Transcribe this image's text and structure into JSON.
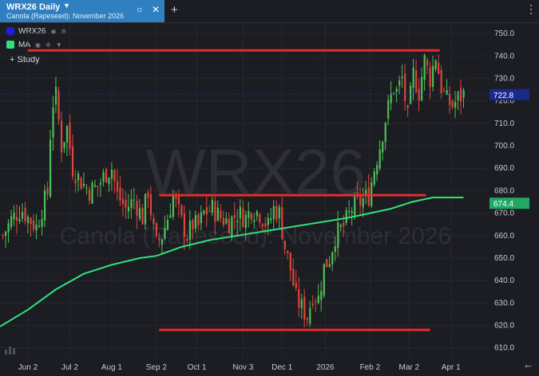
{
  "tab": {
    "title": "WRX26 Daily",
    "subtitle": "Canola (Rapeseed): November 2026",
    "close_glyph": "✕",
    "circle_glyph": "○",
    "add_glyph": "+",
    "more_glyph": "⋮"
  },
  "legend": [
    {
      "name": "WRX26",
      "color": "#1a1fe0"
    },
    {
      "name": "MA",
      "color": "#32e07c"
    }
  ],
  "study_label": "+ Study",
  "watermark": {
    "symbol": "WRX26",
    "description": "Canola (Rapeseed): November 2026"
  },
  "last_price_label": "722.8",
  "ma_price_label": "674.4",
  "back_glyph": "←",
  "colors": {
    "up": "#4fbf55",
    "down": "#e0453a",
    "ma": "#32e07c",
    "line": "#e52b2b",
    "price_badge": "#1a2a8a",
    "ma_badge": "#22a866"
  },
  "chart_data": {
    "type": "candlestick",
    "symbol": "WRX26",
    "interval": "Daily",
    "ylim": [
      606,
      755
    ],
    "y_ticks": [
      "750.0",
      "740.0",
      "730.0",
      "720.0",
      "710.0",
      "700.0",
      "690.0",
      "680.0",
      "670.0",
      "660.0",
      "650.0",
      "640.0",
      "630.0",
      "620.0",
      "610.0"
    ],
    "x_ticks": [
      {
        "label": "Jun 2",
        "day": 0
      },
      {
        "label": "Jul 2",
        "day": 30
      },
      {
        "label": "Aug 1",
        "day": 60
      },
      {
        "label": "Sep 2",
        "day": 92
      },
      {
        "label": "Oct 1",
        "day": 121
      },
      {
        "label": "Nov 3",
        "day": 154
      },
      {
        "label": "Dec 1",
        "day": 182
      },
      {
        "label": "2026",
        "day": 213
      },
      {
        "label": "Feb 2",
        "day": 245
      },
      {
        "label": "Mar 2",
        "day": 273
      },
      {
        "label": "Apr 1",
        "day": 303
      }
    ],
    "day_range": [
      -20,
      330
    ],
    "last_price": 722.8,
    "ma_last": 674.4,
    "close_path": [
      [
        -18,
        660
      ],
      [
        -12,
        667
      ],
      [
        -5,
        672
      ],
      [
        0,
        668
      ],
      [
        6,
        664
      ],
      [
        10,
        672
      ],
      [
        14,
        679
      ],
      [
        17,
        718
      ],
      [
        20,
        722
      ],
      [
        24,
        700
      ],
      [
        28,
        708
      ],
      [
        32,
        690
      ],
      [
        38,
        684
      ],
      [
        44,
        680
      ],
      [
        50,
        682
      ],
      [
        56,
        688
      ],
      [
        60,
        690
      ],
      [
        64,
        678
      ],
      [
        70,
        672
      ],
      [
        76,
        676
      ],
      [
        82,
        668
      ],
      [
        86,
        680
      ],
      [
        90,
        662
      ],
      [
        92,
        656
      ],
      [
        96,
        660
      ],
      [
        100,
        668
      ],
      [
        104,
        678
      ],
      [
        110,
        666
      ],
      [
        114,
        660
      ],
      [
        118,
        665
      ],
      [
        122,
        664
      ],
      [
        126,
        670
      ],
      [
        132,
        672
      ],
      [
        138,
        668
      ],
      [
        144,
        666
      ],
      [
        150,
        670
      ],
      [
        156,
        668
      ],
      [
        160,
        672
      ],
      [
        166,
        670
      ],
      [
        172,
        664
      ],
      [
        176,
        672
      ],
      [
        180,
        670
      ],
      [
        184,
        655
      ],
      [
        188,
        645
      ],
      [
        192,
        632
      ],
      [
        196,
        628
      ],
      [
        200,
        624
      ],
      [
        204,
        634
      ],
      [
        208,
        632
      ],
      [
        212,
        646
      ],
      [
        216,
        650
      ],
      [
        220,
        660
      ],
      [
        226,
        664
      ],
      [
        232,
        672
      ],
      [
        238,
        675
      ],
      [
        244,
        678
      ],
      [
        248,
        690
      ],
      [
        252,
        700
      ],
      [
        256,
        712
      ],
      [
        260,
        722
      ],
      [
        262,
        726
      ],
      [
        264,
        724
      ],
      [
        268,
        730
      ],
      [
        272,
        712
      ],
      [
        276,
        732
      ],
      [
        280,
        724
      ],
      [
        284,
        738
      ],
      [
        288,
        730
      ],
      [
        292,
        740
      ],
      [
        296,
        726
      ],
      [
        300,
        720
      ],
      [
        304,
        718
      ],
      [
        308,
        721
      ],
      [
        312,
        723
      ]
    ],
    "ma_series": [
      [
        -20,
        619.5
      ],
      [
        0,
        627
      ],
      [
        20,
        636
      ],
      [
        40,
        643
      ],
      [
        60,
        647
      ],
      [
        80,
        650
      ],
      [
        92,
        651
      ],
      [
        110,
        655
      ],
      [
        130,
        658
      ],
      [
        150,
        660
      ],
      [
        170,
        662
      ],
      [
        190,
        664
      ],
      [
        210,
        666
      ],
      [
        230,
        668
      ],
      [
        245,
        670
      ],
      [
        260,
        672
      ],
      [
        275,
        675
      ],
      [
        290,
        677
      ],
      [
        300,
        677
      ],
      [
        312,
        677
      ]
    ],
    "horizontal_lines": [
      {
        "from_day": 0,
        "to_day": 295,
        "value": 742.5
      },
      {
        "from_day": 94,
        "to_day": 285,
        "value": 678
      },
      {
        "from_day": 94,
        "to_day": 288,
        "value": 618
      }
    ]
  }
}
